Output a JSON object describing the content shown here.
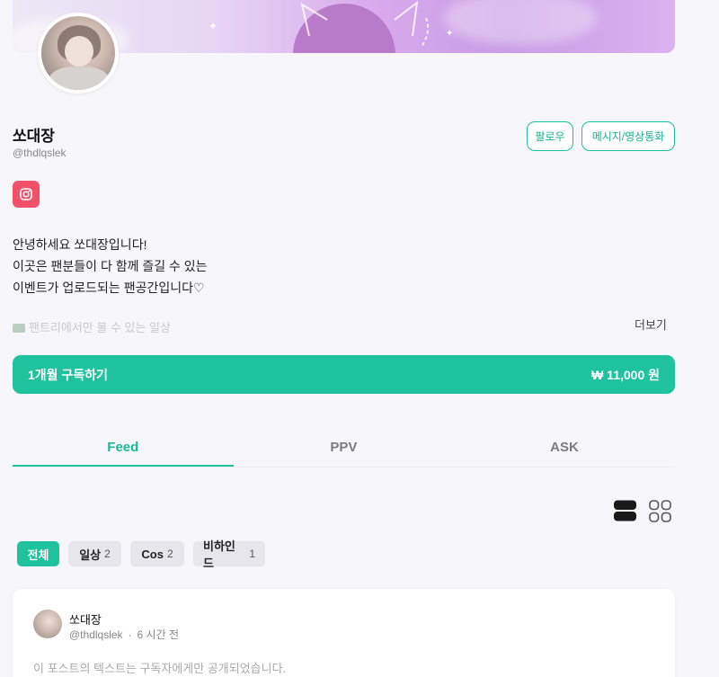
{
  "profile": {
    "name": "쏘대장",
    "handle": "@thdlqslek",
    "follow_label": "팔로우",
    "message_label": "메시지/영상통화",
    "instagram_icon": "instagram-icon",
    "bio_lines": [
      "안녕하세요 쏘대장입니다!",
      "이곳은 팬분들이 다 함께 즐길 수 있는",
      "이벤트가 업로드되는 팬공간입니다♡"
    ],
    "bio_faded": "팬트리에서만 볼 수 있는 일상",
    "more_label": "더보기"
  },
  "subscribe": {
    "label": "1개월 구독하기",
    "price": "₩ 11,000 원"
  },
  "tabs": [
    {
      "label": "Feed",
      "active": true
    },
    {
      "label": "PPV",
      "active": false
    },
    {
      "label": "ASK",
      "active": false
    }
  ],
  "filters": [
    {
      "label": "전체",
      "count": ""
    },
    {
      "label": "일상",
      "count": "2"
    },
    {
      "label": "Cos",
      "count": "2"
    },
    {
      "label": "비하인드",
      "count": "1"
    }
  ],
  "post": {
    "author": "쏘대장",
    "handle": "@thdlqslek",
    "separator": "·",
    "time": "6 시간 전",
    "locked_text": "이 포스트의 텍스트는 구독자에게만 공개되었습니다."
  },
  "colors": {
    "accent": "#1ec39e",
    "instagram": "#f25169"
  }
}
